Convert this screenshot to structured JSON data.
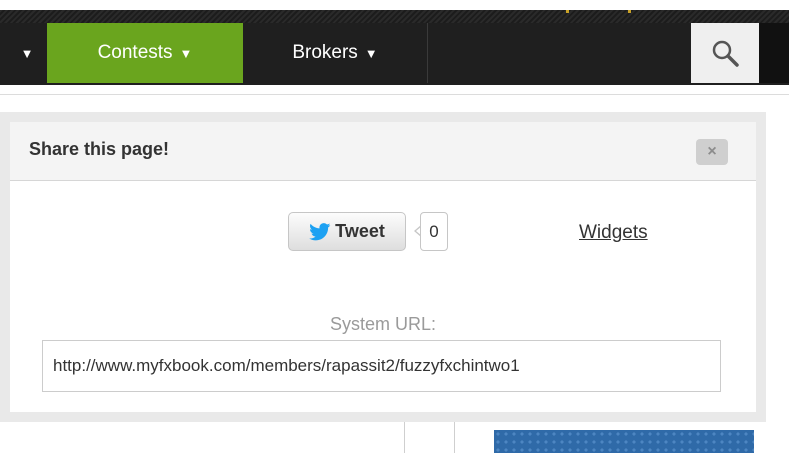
{
  "nav": {
    "items": [
      {
        "label": "",
        "caret": "▼"
      },
      {
        "label": "Contests",
        "caret": "▼"
      },
      {
        "label": "Brokers",
        "caret": "▼"
      }
    ],
    "search_icon": "search-icon",
    "colors": {
      "bar": "#1f1f1f",
      "active": "#6aa51e"
    }
  },
  "dialog": {
    "title": "Share this page!",
    "close_label": "×",
    "tweet": {
      "label": "Tweet",
      "count": "0",
      "icon": "twitter-bird-icon",
      "brand_color": "#1da1f2"
    },
    "widgets_label": "Widgets",
    "url_label": "System URL:",
    "url_value": "http://www.myfxbook.com/members/rapassit2/fuzzyfxchintwo1"
  }
}
